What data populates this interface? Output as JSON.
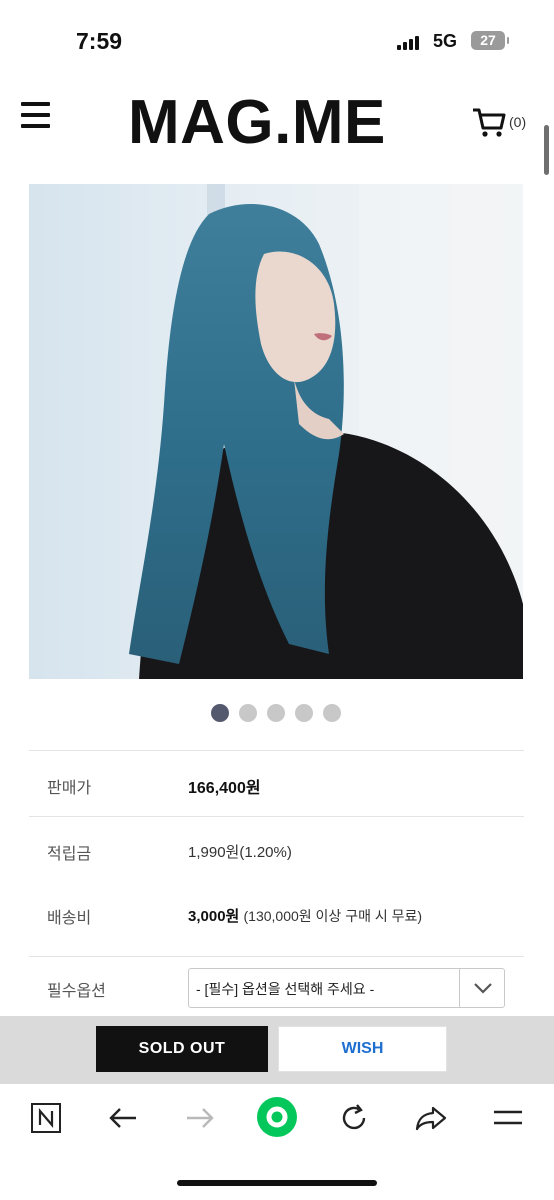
{
  "status_bar": {
    "time": "7:59",
    "network": "5G",
    "battery": "27"
  },
  "header": {
    "logo": "MAG.ME",
    "cart_count": "(0)"
  },
  "gallery": {
    "total_pages": 5,
    "active_page": 1
  },
  "product_info": {
    "price": {
      "label": "판매가",
      "value": "166,400원"
    },
    "points": {
      "label": "적립금",
      "value": "1,990원(1.20%)"
    },
    "shipping": {
      "label": "배송비",
      "value": "3,000원",
      "note": "(130,000원 이상 구매 시 무료)"
    },
    "option": {
      "label": "필수옵션",
      "placeholder": "- [필수] 옵션을 선택해 주세요 -"
    }
  },
  "actions": {
    "sold_out_label": "SOLD OUT",
    "wish_label": "WISH"
  },
  "browser_bar": {
    "icons": [
      "naver-n-icon",
      "back-arrow-icon",
      "forward-arrow-icon",
      "naver-green-icon",
      "refresh-icon",
      "share-icon",
      "menu-icon"
    ],
    "accent_color": "#03c75a"
  }
}
